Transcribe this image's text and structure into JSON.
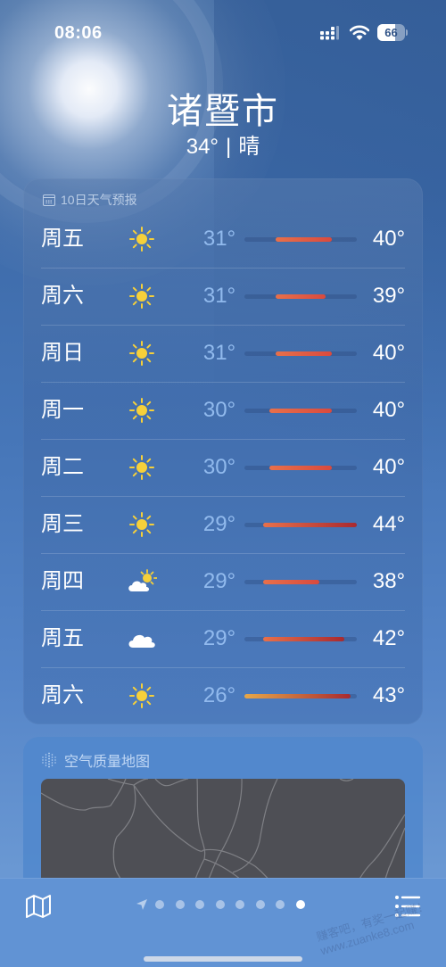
{
  "status_bar": {
    "time": "08:06",
    "battery_level": 66,
    "battery_label": "66",
    "signal_icon": "cellular-signal-icon",
    "wifi_icon": "wifi-icon"
  },
  "header": {
    "city": "诸暨市",
    "current_temp": "34°",
    "separator": "|",
    "condition": "晴"
  },
  "forecast": {
    "title": "10日天气预报",
    "icon": "calendar-icon",
    "range_min": 26,
    "range_max": 44,
    "days": [
      {
        "day": "周五",
        "icon": "sun",
        "low": 31,
        "high": 40,
        "low_label": "31°",
        "high_label": "40°"
      },
      {
        "day": "周六",
        "icon": "sun",
        "low": 31,
        "high": 39,
        "low_label": "31°",
        "high_label": "39°"
      },
      {
        "day": "周日",
        "icon": "sun",
        "low": 31,
        "high": 40,
        "low_label": "31°",
        "high_label": "40°"
      },
      {
        "day": "周一",
        "icon": "sun",
        "low": 30,
        "high": 40,
        "low_label": "30°",
        "high_label": "40°"
      },
      {
        "day": "周二",
        "icon": "sun",
        "low": 30,
        "high": 40,
        "low_label": "30°",
        "high_label": "40°"
      },
      {
        "day": "周三",
        "icon": "sun",
        "low": 29,
        "high": 44,
        "low_label": "29°",
        "high_label": "44°"
      },
      {
        "day": "周四",
        "icon": "partly-cloudy",
        "low": 29,
        "high": 38,
        "low_label": "29°",
        "high_label": "38°"
      },
      {
        "day": "周五",
        "icon": "cloud",
        "low": 29,
        "high": 42,
        "low_label": "29°",
        "high_label": "42°"
      },
      {
        "day": "周六",
        "icon": "sun",
        "low": 26,
        "high": 43,
        "low_label": "26°",
        "high_label": "43°"
      }
    ]
  },
  "air_quality": {
    "title": "空气质量地图",
    "icon": "air-quality-icon"
  },
  "bottom_bar": {
    "map_icon": "map-icon",
    "list_icon": "list-icon",
    "location_icon": "location-arrow-icon",
    "page_count": 8,
    "active_page": 8,
    "watermark_line1": "赚客吧，有奖一起赚！",
    "watermark_line2": "www.zuanke8.com"
  },
  "colors": {
    "bar_cool": "#e8a848",
    "bar_warm": "#e8704a",
    "bar_hot": "#d94a3e",
    "bar_very_hot": "#a82a30",
    "sun_yellow": "#f6d03a"
  }
}
